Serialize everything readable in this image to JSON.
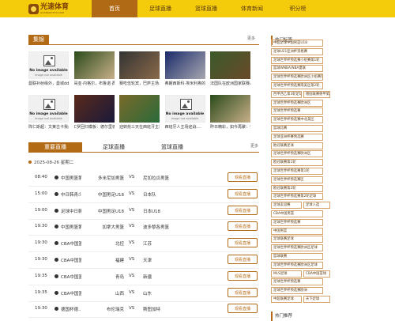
{
  "logo": {
    "name": "光速体育",
    "sub": "GUANGSUTIYU.COM"
  },
  "nav": [
    "首页",
    "足球直播",
    "篮球直播",
    "体育新闻",
    "积分榜"
  ],
  "news": {
    "title": "集锦",
    "more": "更多",
    "items": [
      {
        "cap": "曼联补射缘外，曼城dd直直...",
        "img": "placeholder"
      },
      {
        "cap": "哥亚·内格尔，布鲁诺·费尔...",
        "img": "photo"
      },
      {
        "cap": "赛吃伍轮宾，巴萨主场...",
        "img": "photo"
      },
      {
        "cap": "弗朗西斯科·埃米利奥的...",
        "img": "photo"
      },
      {
        "cap": "法国队在欧洲国家联赛A组...",
        "img": "photo"
      },
      {
        "cap": "阵仁斯超：文莱古卡我杀...",
        "img": "placeholder"
      },
      {
        "cap": "C罗回归模板：德尔里德头...",
        "img": "photo"
      },
      {
        "cap": "迎转抢三天在西班牙主场山...",
        "img": "photo"
      },
      {
        "cap": "西班牙人主场迎战....",
        "img": "placeholder"
      },
      {
        "cap": "昨日精彩，如今再聚：鲁岛...",
        "img": "photo"
      }
    ],
    "placeholder_title": "No image available",
    "placeholder_sub": "image not available"
  },
  "schedule": {
    "tabs": [
      "重要直播",
      "足球直播",
      "篮球直播"
    ],
    "more": "更多",
    "date": "2025-08-26 星期二",
    "vs": "VS",
    "btn": "观看直播",
    "rows": [
      {
        "time": "08:40",
        "lg": "中国男篮第...",
        "home": "多米尼加男篮",
        "away": "尼加拉瓜男篮"
      },
      {
        "time": "15:00",
        "lg": "中日韩青少...",
        "home": "中国男足U18",
        "away": "日本队"
      },
      {
        "time": "19:00",
        "lg": "足球中日韩...",
        "home": "中国男足U18",
        "away": "日本U18"
      },
      {
        "time": "19:30",
        "lg": "中国男篮第...",
        "home": "加拿大男篮",
        "away": "波多黎各男篮"
      },
      {
        "time": "19:30",
        "lg": "CBA中国篮...",
        "home": "北控",
        "away": "江苏"
      },
      {
        "time": "19:30",
        "lg": "CBA中国篮...",
        "home": "福建",
        "away": "天津"
      },
      {
        "time": "19:35",
        "lg": "CBA中国篮...",
        "home": "青岛",
        "away": "新疆"
      },
      {
        "time": "19:35",
        "lg": "CBA中国篮...",
        "home": "山西",
        "away": "山东"
      },
      {
        "time": "19:30",
        "lg": "德国杯德...",
        "home": "布伦瑞克",
        "away": "斯图加特"
      }
    ]
  },
  "sidebar": {
    "title": "热门标签",
    "tags": [
      "中超足球中国男篮U18",
      "足球U21亚洲杯资格赛",
      "足球世界杯预选赛小组赛第1轮",
      "篮球WNBA/NBA夏联",
      "足球世界杯预选赛欧洲区小组赛第1轮",
      "足球世界杯预选赛南美区第2轮",
      "西甲西乙第3轮足球",
      "德国联赛德甲第1轮足球",
      "足球世界杯预选赛欧洲区",
      "足球世界杯预选赛",
      "足球世界杯预选赛中北美区",
      "篮球比赛",
      "足球亚洲杯赛预选赛",
      "欧冠联赛足球",
      "足球世界杯预选赛欧洲区",
      "欧冠联赛第1轮",
      "足球世界杯预选赛第1轮",
      "足球世界杯预选赛区",
      "欧冠联赛第2轮",
      "足球世界杯预选赛第2轮足球",
      "足球友谊赛",
      "足球入选",
      "CBA中国男篮",
      "足球世界杯预选赛",
      "中国男篮",
      "足球联赛足球",
      "足球世界杯预选赛欧洲区足球",
      "篮球联赛",
      "足球世界杯预选赛欧洲区足球",
      "MLS足球",
      "CBA中国篮球",
      "足球世界杯预选赛",
      "足球世界杯预选赛欧洲",
      "中超联赛足球",
      "天下足球",
      "足球世界杯",
      "水晶宫足球",
      "足球世界杯预选赛",
      "足球世界杯预选赛"
    ],
    "title2": "热门推荐"
  }
}
